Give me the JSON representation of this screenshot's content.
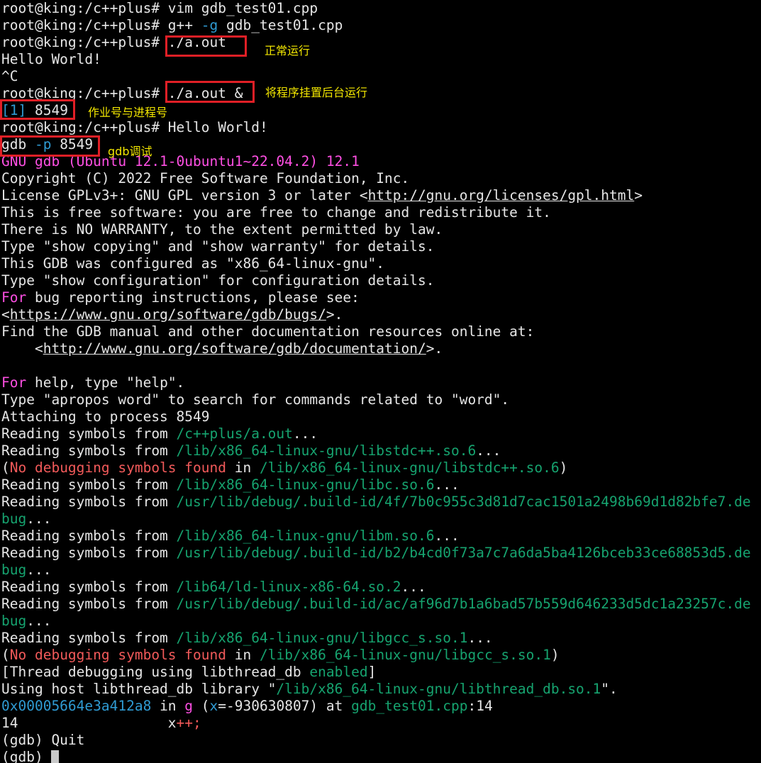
{
  "colors": {
    "background": "#000000",
    "text": "#e6e6e6",
    "magenta": "#ff4fe3",
    "cyan": "#2f9bd3",
    "green": "#16a36f",
    "red": "#f25a5a",
    "annotation_box": "#e01f26",
    "annotation_text": "#f2e600"
  },
  "terminal": {
    "lines": [
      [
        {
          "t": "root@king:/c++plus# vim gdb_test01.cpp"
        }
      ],
      [
        {
          "t": "root@king:/c++plus# g++ "
        },
        {
          "t": "-g",
          "c": "cyan"
        },
        {
          "t": " gdb_test01.cpp"
        }
      ],
      [
        {
          "t": "root@king:/c++plus# ./a.out"
        }
      ],
      [
        {
          "t": "Hello World!"
        }
      ],
      [
        {
          "t": "^C"
        }
      ],
      [
        {
          "t": "root@king:/c++plus# ./a.out &"
        }
      ],
      [
        {
          "t": "[1]",
          "c": "cyan"
        },
        {
          "t": " 8549"
        }
      ],
      [
        {
          "t": "root@king:/c++plus# Hello World!"
        }
      ],
      [
        {
          "t": "gdb "
        },
        {
          "t": "-p",
          "c": "cyan"
        },
        {
          "t": " 8549"
        }
      ],
      [
        {
          "t": "GNU gdb (Ubuntu 12.1-0ubuntu1~22.04.2) 12.1",
          "c": "magenta"
        }
      ],
      [
        {
          "t": "Copyright (C) 2022 Free Software Foundation, Inc."
        }
      ],
      [
        {
          "t": "License GPLv3+: GNU GPL version 3 or later <"
        },
        {
          "t": "http://gnu.org/licenses/gpl.html",
          "c": "link"
        },
        {
          "t": ">"
        }
      ],
      [
        {
          "t": "This is free software: you are free to change and redistribute it."
        }
      ],
      [
        {
          "t": "There is NO WARRANTY, to the extent permitted by law."
        }
      ],
      [
        {
          "t": "Type \"show copying\" and \"show warranty\" for details."
        }
      ],
      [
        {
          "t": "This GDB was configured as \"x86_64-linux-gnu\"."
        }
      ],
      [
        {
          "t": "Type \"show configuration\" for configuration details."
        }
      ],
      [
        {
          "t": "For",
          "c": "magenta"
        },
        {
          "t": " bug reporting instructions, please see:"
        }
      ],
      [
        {
          "t": "<"
        },
        {
          "t": "https://www.gnu.org/software/gdb/bugs/",
          "c": "link"
        },
        {
          "t": ">."
        }
      ],
      [
        {
          "t": "Find the GDB manual and other documentation resources online at:"
        }
      ],
      [
        {
          "t": "    <"
        },
        {
          "t": "http://www.gnu.org/software/gdb/documentation/",
          "c": "link"
        },
        {
          "t": ">."
        }
      ],
      [
        {
          "t": ""
        }
      ],
      [
        {
          "t": "For",
          "c": "magenta"
        },
        {
          "t": " help, type \"help\"."
        }
      ],
      [
        {
          "t": "Type \"apropos word\" to search for commands related to \"word\"."
        }
      ],
      [
        {
          "t": "Attaching to process 8549"
        }
      ],
      [
        {
          "t": "Reading symbols from "
        },
        {
          "t": "/c++plus/a.out",
          "c": "green"
        },
        {
          "t": "..."
        }
      ],
      [
        {
          "t": "Reading symbols from "
        },
        {
          "t": "/lib/x86_64-linux-gnu/libstdc++.so.6",
          "c": "green"
        },
        {
          "t": "..."
        }
      ],
      [
        {
          "t": "("
        },
        {
          "t": "No debugging symbols found",
          "c": "red"
        },
        {
          "t": " in "
        },
        {
          "t": "/lib/x86_64-linux-gnu/libstdc++.so.6",
          "c": "green"
        },
        {
          "t": ")"
        }
      ],
      [
        {
          "t": "Reading symbols from "
        },
        {
          "t": "/lib/x86_64-linux-gnu/libc.so.6",
          "c": "green"
        },
        {
          "t": "..."
        }
      ],
      [
        {
          "t": "Reading symbols from "
        },
        {
          "t": "/usr/lib/debug/.build-id/4f/7b0c955c3d81d7cac1501a2498b69d1d82bfe7.de",
          "c": "green"
        }
      ],
      [
        {
          "t": "bug",
          "c": "green"
        },
        {
          "t": "..."
        }
      ],
      [
        {
          "t": "Reading symbols from "
        },
        {
          "t": "/lib/x86_64-linux-gnu/libm.so.6",
          "c": "green"
        },
        {
          "t": "..."
        }
      ],
      [
        {
          "t": "Reading symbols from "
        },
        {
          "t": "/usr/lib/debug/.build-id/b2/b4cd0f73a7c7a6da5ba4126bceb33ce68853d5.de",
          "c": "green"
        }
      ],
      [
        {
          "t": "bug",
          "c": "green"
        },
        {
          "t": "..."
        }
      ],
      [
        {
          "t": "Reading symbols from "
        },
        {
          "t": "/lib64/ld-linux-x86-64.so.2",
          "c": "green"
        },
        {
          "t": "..."
        }
      ],
      [
        {
          "t": "Reading symbols from "
        },
        {
          "t": "/usr/lib/debug/.build-id/ac/af96d7b1a6bad57b559d646233d5dc1a23257c.de",
          "c": "green"
        }
      ],
      [
        {
          "t": "bug",
          "c": "green"
        },
        {
          "t": "..."
        }
      ],
      [
        {
          "t": "Reading symbols from "
        },
        {
          "t": "/lib/x86_64-linux-gnu/libgcc_s.so.1",
          "c": "green"
        },
        {
          "t": "..."
        }
      ],
      [
        {
          "t": "("
        },
        {
          "t": "No debugging symbols found",
          "c": "red"
        },
        {
          "t": " in "
        },
        {
          "t": "/lib/x86_64-linux-gnu/libgcc_s.so.1",
          "c": "green"
        },
        {
          "t": ")"
        }
      ],
      [
        {
          "t": "[Thread debugging using libthread_db "
        },
        {
          "t": "enabled",
          "c": "green"
        },
        {
          "t": "]"
        }
      ],
      [
        {
          "t": "Using host libthread_db library \""
        },
        {
          "t": "/lib/x86_64-linux-gnu/libthread_db.so.1",
          "c": "green"
        },
        {
          "t": "\"."
        }
      ],
      [
        {
          "t": "0x00005664e3a412a8",
          "c": "cyan"
        },
        {
          "t": " in "
        },
        {
          "t": "g",
          "c": "magenta"
        },
        {
          "t": " ("
        },
        {
          "t": "x",
          "c": "cyan"
        },
        {
          "t": "=-930630807) at "
        },
        {
          "t": "gdb_test01.cpp",
          "c": "green"
        },
        {
          "t": ":14"
        }
      ],
      [
        {
          "t": "14                  x"
        },
        {
          "t": "++;",
          "c": "red"
        }
      ],
      [
        {
          "t": "(gdb) Quit"
        }
      ],
      [
        {
          "t": "(gdb) "
        },
        {
          "cursor": true
        }
      ]
    ]
  },
  "annotations": [
    {
      "label": "正常运行",
      "line": 2
    },
    {
      "label": "将程序挂置后台运行",
      "line": 5
    },
    {
      "label": "作业号与进程号",
      "line": 6
    },
    {
      "label": "gdb调试",
      "line": 8
    }
  ]
}
